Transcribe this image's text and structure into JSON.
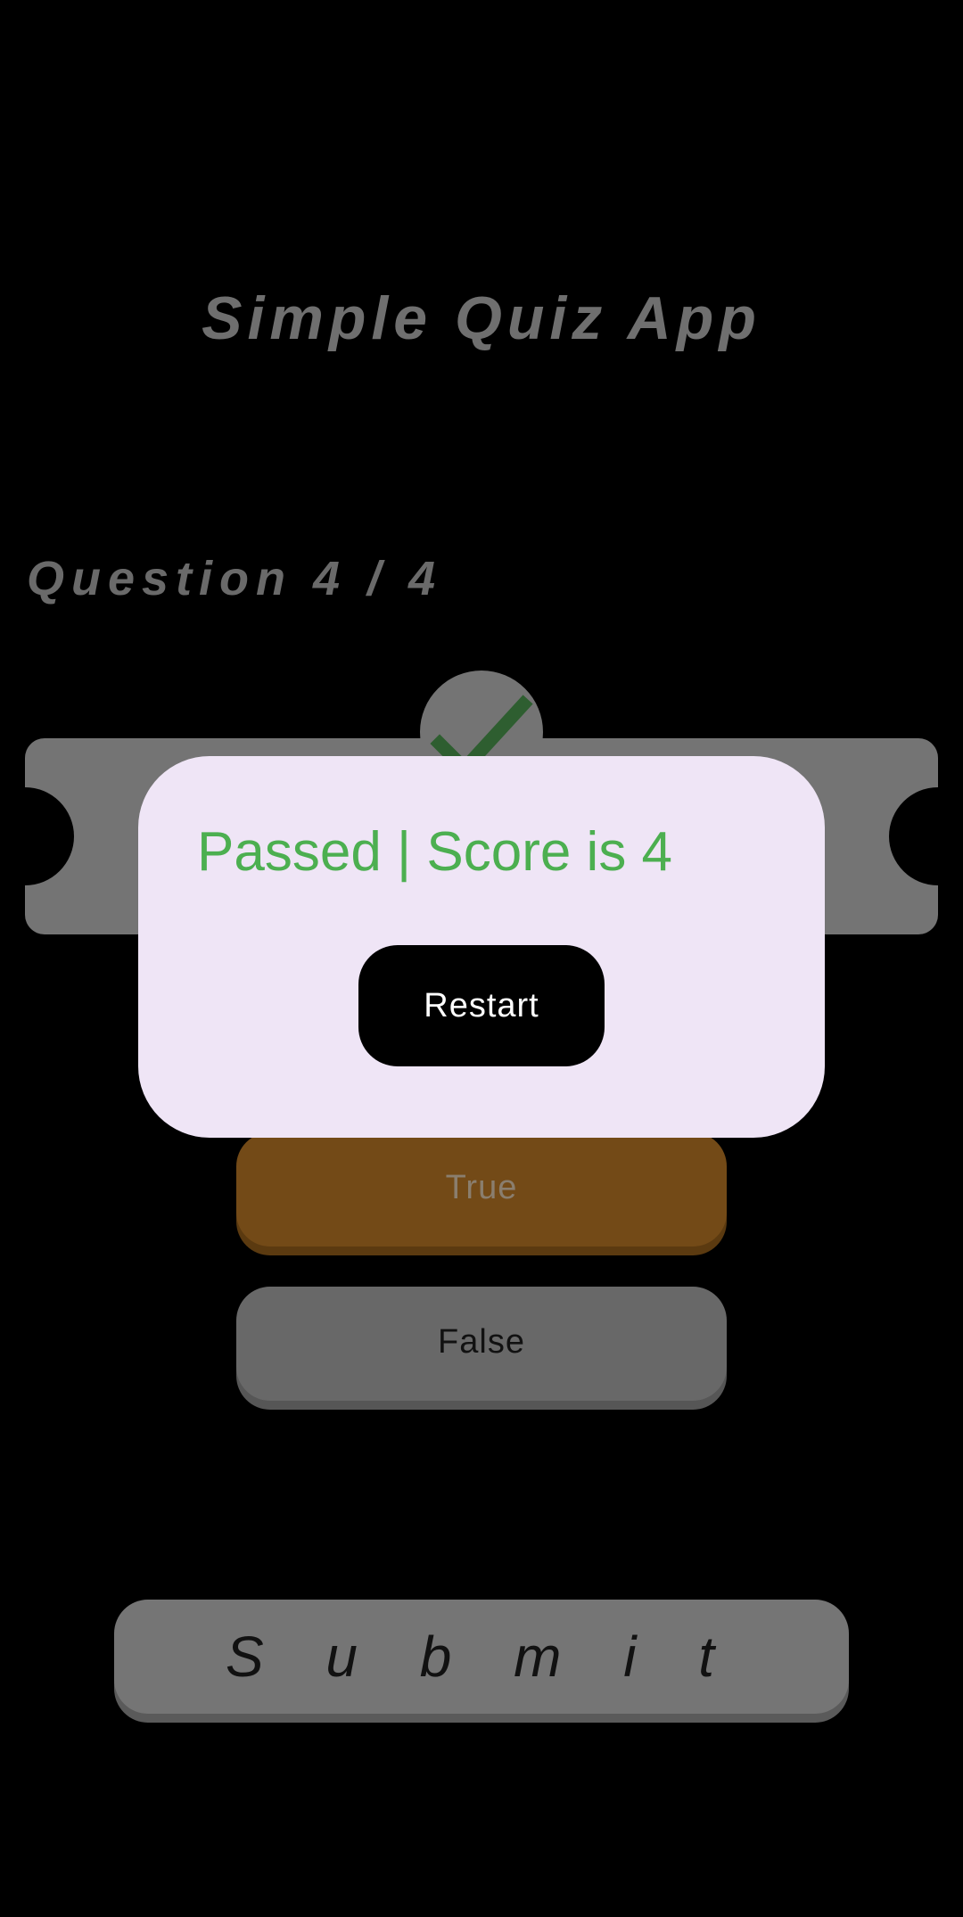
{
  "app": {
    "title": "Simple Quiz App"
  },
  "quiz": {
    "question_counter": "Question 4 / 4",
    "answers": {
      "true_label": "True",
      "false_label": "False"
    },
    "submit_label": "S u b m i t"
  },
  "result_dialog": {
    "message": "Passed | Score is 4",
    "restart_label": "Restart"
  },
  "icons": {
    "result": "check-icon"
  },
  "colors": {
    "background": "#000000",
    "dialog_background": "#efe5f6",
    "pass_text": "#4caf50",
    "selected_answer": "#734a17",
    "dimmed_surface": "#747474",
    "check": "#2e5e30"
  }
}
